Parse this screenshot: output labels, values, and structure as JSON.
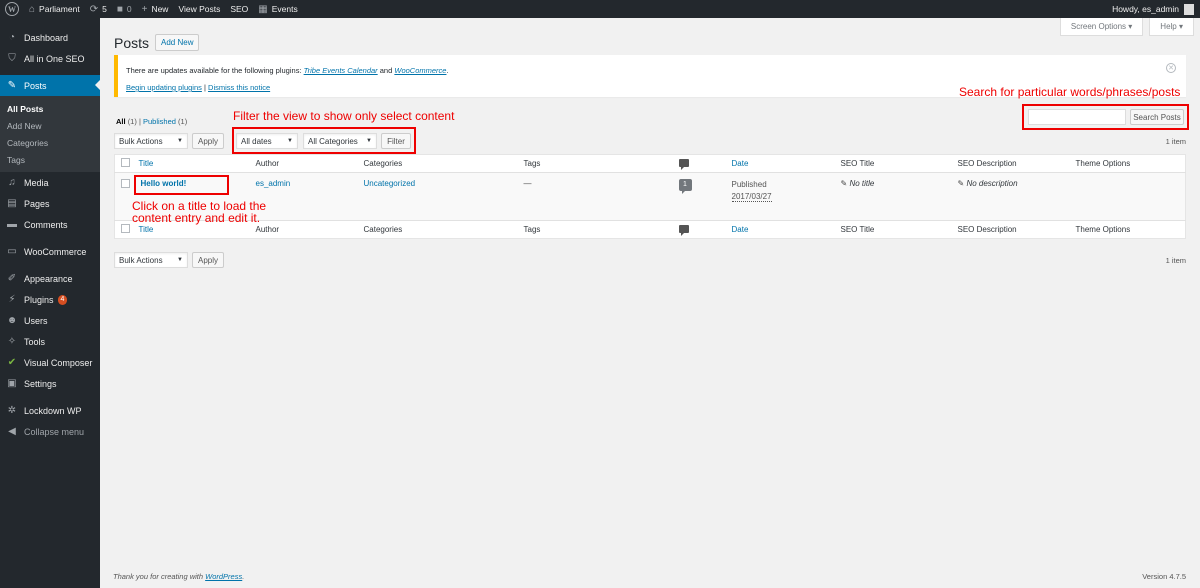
{
  "adminbar": {
    "site_name": "Parliament",
    "updates_count": "5",
    "comments_count": "0",
    "new_label": "New",
    "view_posts": "View Posts",
    "seo": "SEO",
    "events": "Events",
    "howdy": "Howdy, es_admin"
  },
  "sidebar": {
    "items": [
      {
        "label": "Dashboard",
        "icon": "dashboard-icon"
      },
      {
        "label": "All in One SEO",
        "icon": "shield-icon"
      },
      {
        "label": "Posts",
        "icon": "pin-icon"
      },
      {
        "label": "Media",
        "icon": "media-icon"
      },
      {
        "label": "Pages",
        "icon": "page-icon"
      },
      {
        "label": "Comments",
        "icon": "comment-icon"
      },
      {
        "label": "WooCommerce",
        "icon": "woo-icon"
      },
      {
        "label": "Appearance",
        "icon": "brush-icon"
      },
      {
        "label": "Plugins",
        "icon": "plug-icon",
        "badge": "4"
      },
      {
        "label": "Users",
        "icon": "user-icon"
      },
      {
        "label": "Tools",
        "icon": "wrench-icon"
      },
      {
        "label": "Visual Composer",
        "icon": "vc-icon"
      },
      {
        "label": "Settings",
        "icon": "settings-icon"
      },
      {
        "label": "Lockdown WP",
        "icon": "gear-icon"
      },
      {
        "label": "Collapse menu",
        "icon": "collapse-icon"
      }
    ],
    "posts_sub": [
      "All Posts",
      "Add New",
      "Categories",
      "Tags"
    ]
  },
  "header": {
    "title": "Posts",
    "add_new": "Add New",
    "screen_options": "Screen Options",
    "help": "Help"
  },
  "notice": {
    "text_before": "There are updates available for the following plugins: ",
    "plugin1": "Tribe Events Calendar",
    "and": " and ",
    "plugin2": "WooCommerce",
    "period": ".",
    "begin_updating": "Begin updating plugins",
    "sep": " | ",
    "dismiss": "Dismiss this notice"
  },
  "annotations": {
    "search": "Search for particular words/phrases/posts",
    "filter": "Filter the view to show only select content",
    "title_line1": "Click on a title to load the",
    "title_line2": "content entry and edit it."
  },
  "views": {
    "all": "All",
    "all_count": "(1)",
    "sep": " | ",
    "published": "Published",
    "published_count": "(1)"
  },
  "toolbar": {
    "bulk_actions": "Bulk Actions",
    "apply": "Apply",
    "all_dates": "All dates",
    "all_categories": "All Categories",
    "filter": "Filter",
    "search_posts": "Search Posts",
    "items": "1 item"
  },
  "table": {
    "columns": [
      "Title",
      "Author",
      "Categories",
      "Tags",
      "",
      "Date",
      "SEO Title",
      "SEO Description",
      "Theme Options"
    ],
    "rows": [
      {
        "title": "Hello world!",
        "author": "es_admin",
        "categories": "Uncategorized",
        "tags": "—",
        "comments": "1",
        "date_status": "Published",
        "date": "2017/03/27",
        "seo_title": "No title",
        "seo_description": "No description",
        "theme_options": ""
      }
    ]
  },
  "footer": {
    "thanks": "Thank you for creating with ",
    "wordpress": "WordPress",
    "period": ".",
    "version": "Version 4.7.5"
  }
}
